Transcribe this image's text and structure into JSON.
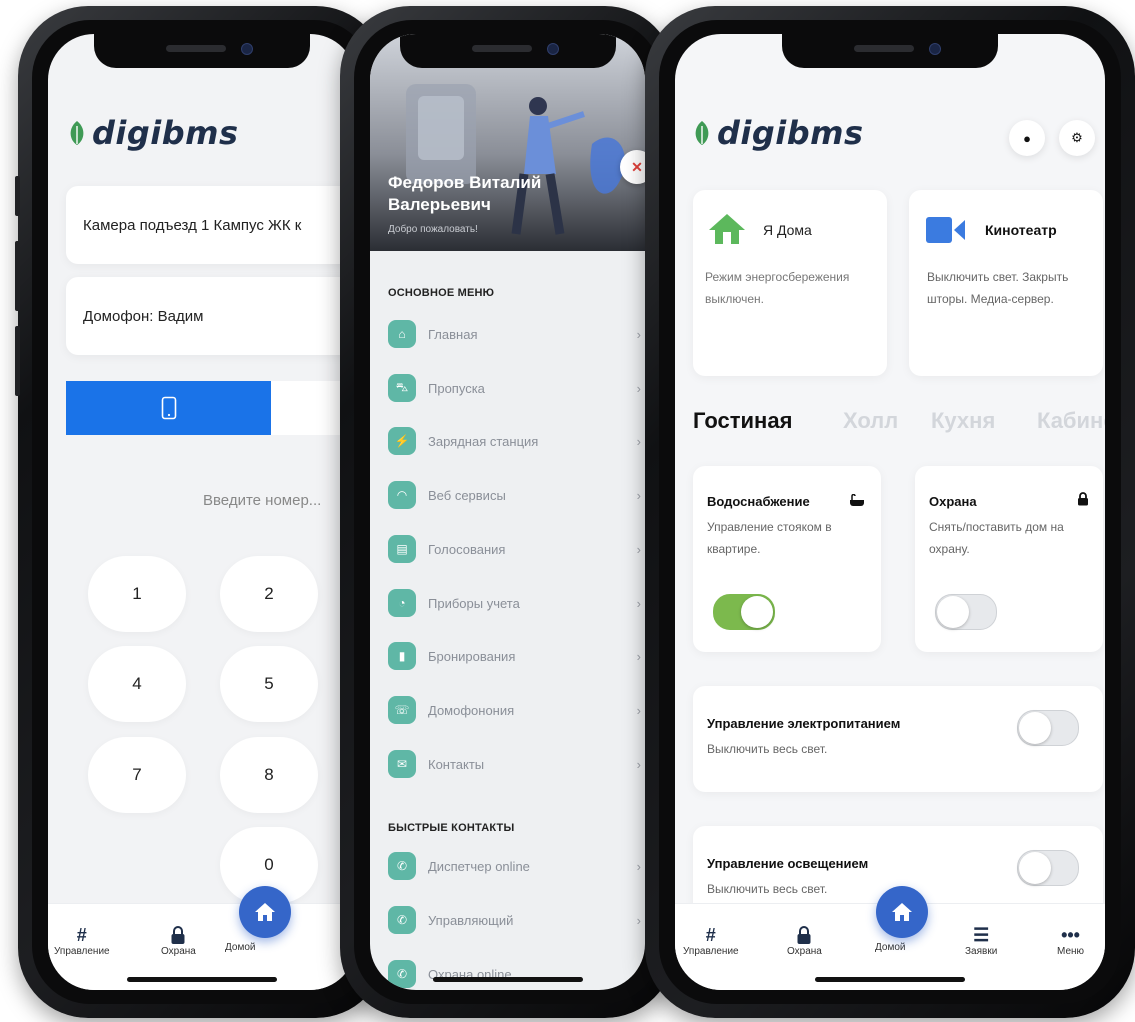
{
  "brand": {
    "name": "digibms",
    "leaf_color": "#3f9a55",
    "text_color": "#1f2f4a"
  },
  "phone1": {
    "camera_label": "Камера подъезд 1 Кампус ЖК к",
    "intercom_label": "Домофон: Вадим",
    "phone_tab_icon": "phone-icon",
    "number_placeholder": "Введите номер...",
    "keys": [
      "1",
      "2",
      "4",
      "5",
      "7",
      "8",
      "0"
    ],
    "tabs": [
      {
        "label": "Управление",
        "icon": "#"
      },
      {
        "label": "Охрана",
        "icon": "lock"
      },
      {
        "label": "Домой",
        "icon": "home"
      }
    ]
  },
  "phone2": {
    "user_name": "Федоров Виталий Валерьевич",
    "greeting": "Добро пожаловать!",
    "close_icon": "✕",
    "main_menu_title": "ОСНОВНОЕ МЕНЮ",
    "main_menu": [
      {
        "label": "Главная",
        "icon": "home-icon"
      },
      {
        "label": "Пропуска",
        "icon": "car-icon"
      },
      {
        "label": "Зарядная станция",
        "icon": "charging-icon"
      },
      {
        "label": "Веб сервисы",
        "icon": "wifi-icon"
      },
      {
        "label": "Голосования",
        "icon": "vote-icon"
      },
      {
        "label": "Приборы учета",
        "icon": "meter-icon"
      },
      {
        "label": "Бронирования",
        "icon": "bookmark-icon"
      },
      {
        "label": "Домофонония",
        "icon": "intercom-icon"
      },
      {
        "label": "Контакты",
        "icon": "mail-icon"
      }
    ],
    "quick_title": "БЫСТРЫЕ КОНТАКТЫ",
    "quick_contacts": [
      {
        "label": "Диспетчер online",
        "icon": "phone-icon"
      },
      {
        "label": "Управляющий",
        "icon": "phone-icon"
      },
      {
        "label": "Охрана online",
        "icon": "phone-icon"
      }
    ]
  },
  "phone3": {
    "scene1": {
      "title": "Я Дома",
      "text": "Режим энергосбережения выключен.",
      "icon": "house-icon",
      "color": "#5cb85c"
    },
    "scene2": {
      "title": "Кинотеатр",
      "text": "Выключить свет. Закрыть шторы. Медиа-сервер.",
      "icon": "video-camera-icon",
      "color": "#3b7be0"
    },
    "rooms": [
      "Гостиная",
      "Холл",
      "Кухня",
      "Кабине"
    ],
    "water": {
      "title": "Водоснабжение",
      "text": "Управление стояком в квартире.",
      "on": true,
      "icon": "bathtub-icon"
    },
    "security": {
      "title": "Охрана",
      "text": "Снять/поставить дом на охрану.",
      "on": false,
      "icon": "lock-icon"
    },
    "power": {
      "title": "Управление электропитанием",
      "text": "Выключить весь свет.",
      "on": false
    },
    "light": {
      "title": "Управление освещением",
      "text": "Выключить весь свет.",
      "on": false
    },
    "tabs": [
      {
        "label": "Управление",
        "icon": "#"
      },
      {
        "label": "Охрана",
        "icon": "lock"
      },
      {
        "label": "Домой",
        "icon": "home"
      },
      {
        "label": "Заявки",
        "icon": "list"
      },
      {
        "label": "Меню",
        "icon": "more"
      }
    ]
  }
}
